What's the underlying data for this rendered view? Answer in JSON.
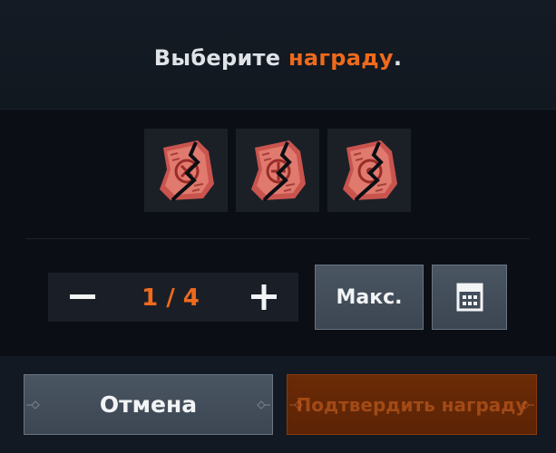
{
  "dialog": {
    "title_prefix": "Выберите ",
    "title_highlight": "награду",
    "title_suffix": "."
  },
  "rewards": [
    {
      "icon": "scroll-icon"
    },
    {
      "icon": "scroll-icon"
    },
    {
      "icon": "scroll-icon"
    }
  ],
  "quantity": {
    "display": "1 / 4",
    "current": 1,
    "max": 4
  },
  "buttons": {
    "max_label": "Макс.",
    "cancel_label": "Отмена",
    "confirm_label": "Подтвердить награду"
  },
  "colors": {
    "accent": "#ef6a1c",
    "background": "#0f151d",
    "button_steel": "#434e5b",
    "confirm_disabled": "#6a2a06"
  }
}
